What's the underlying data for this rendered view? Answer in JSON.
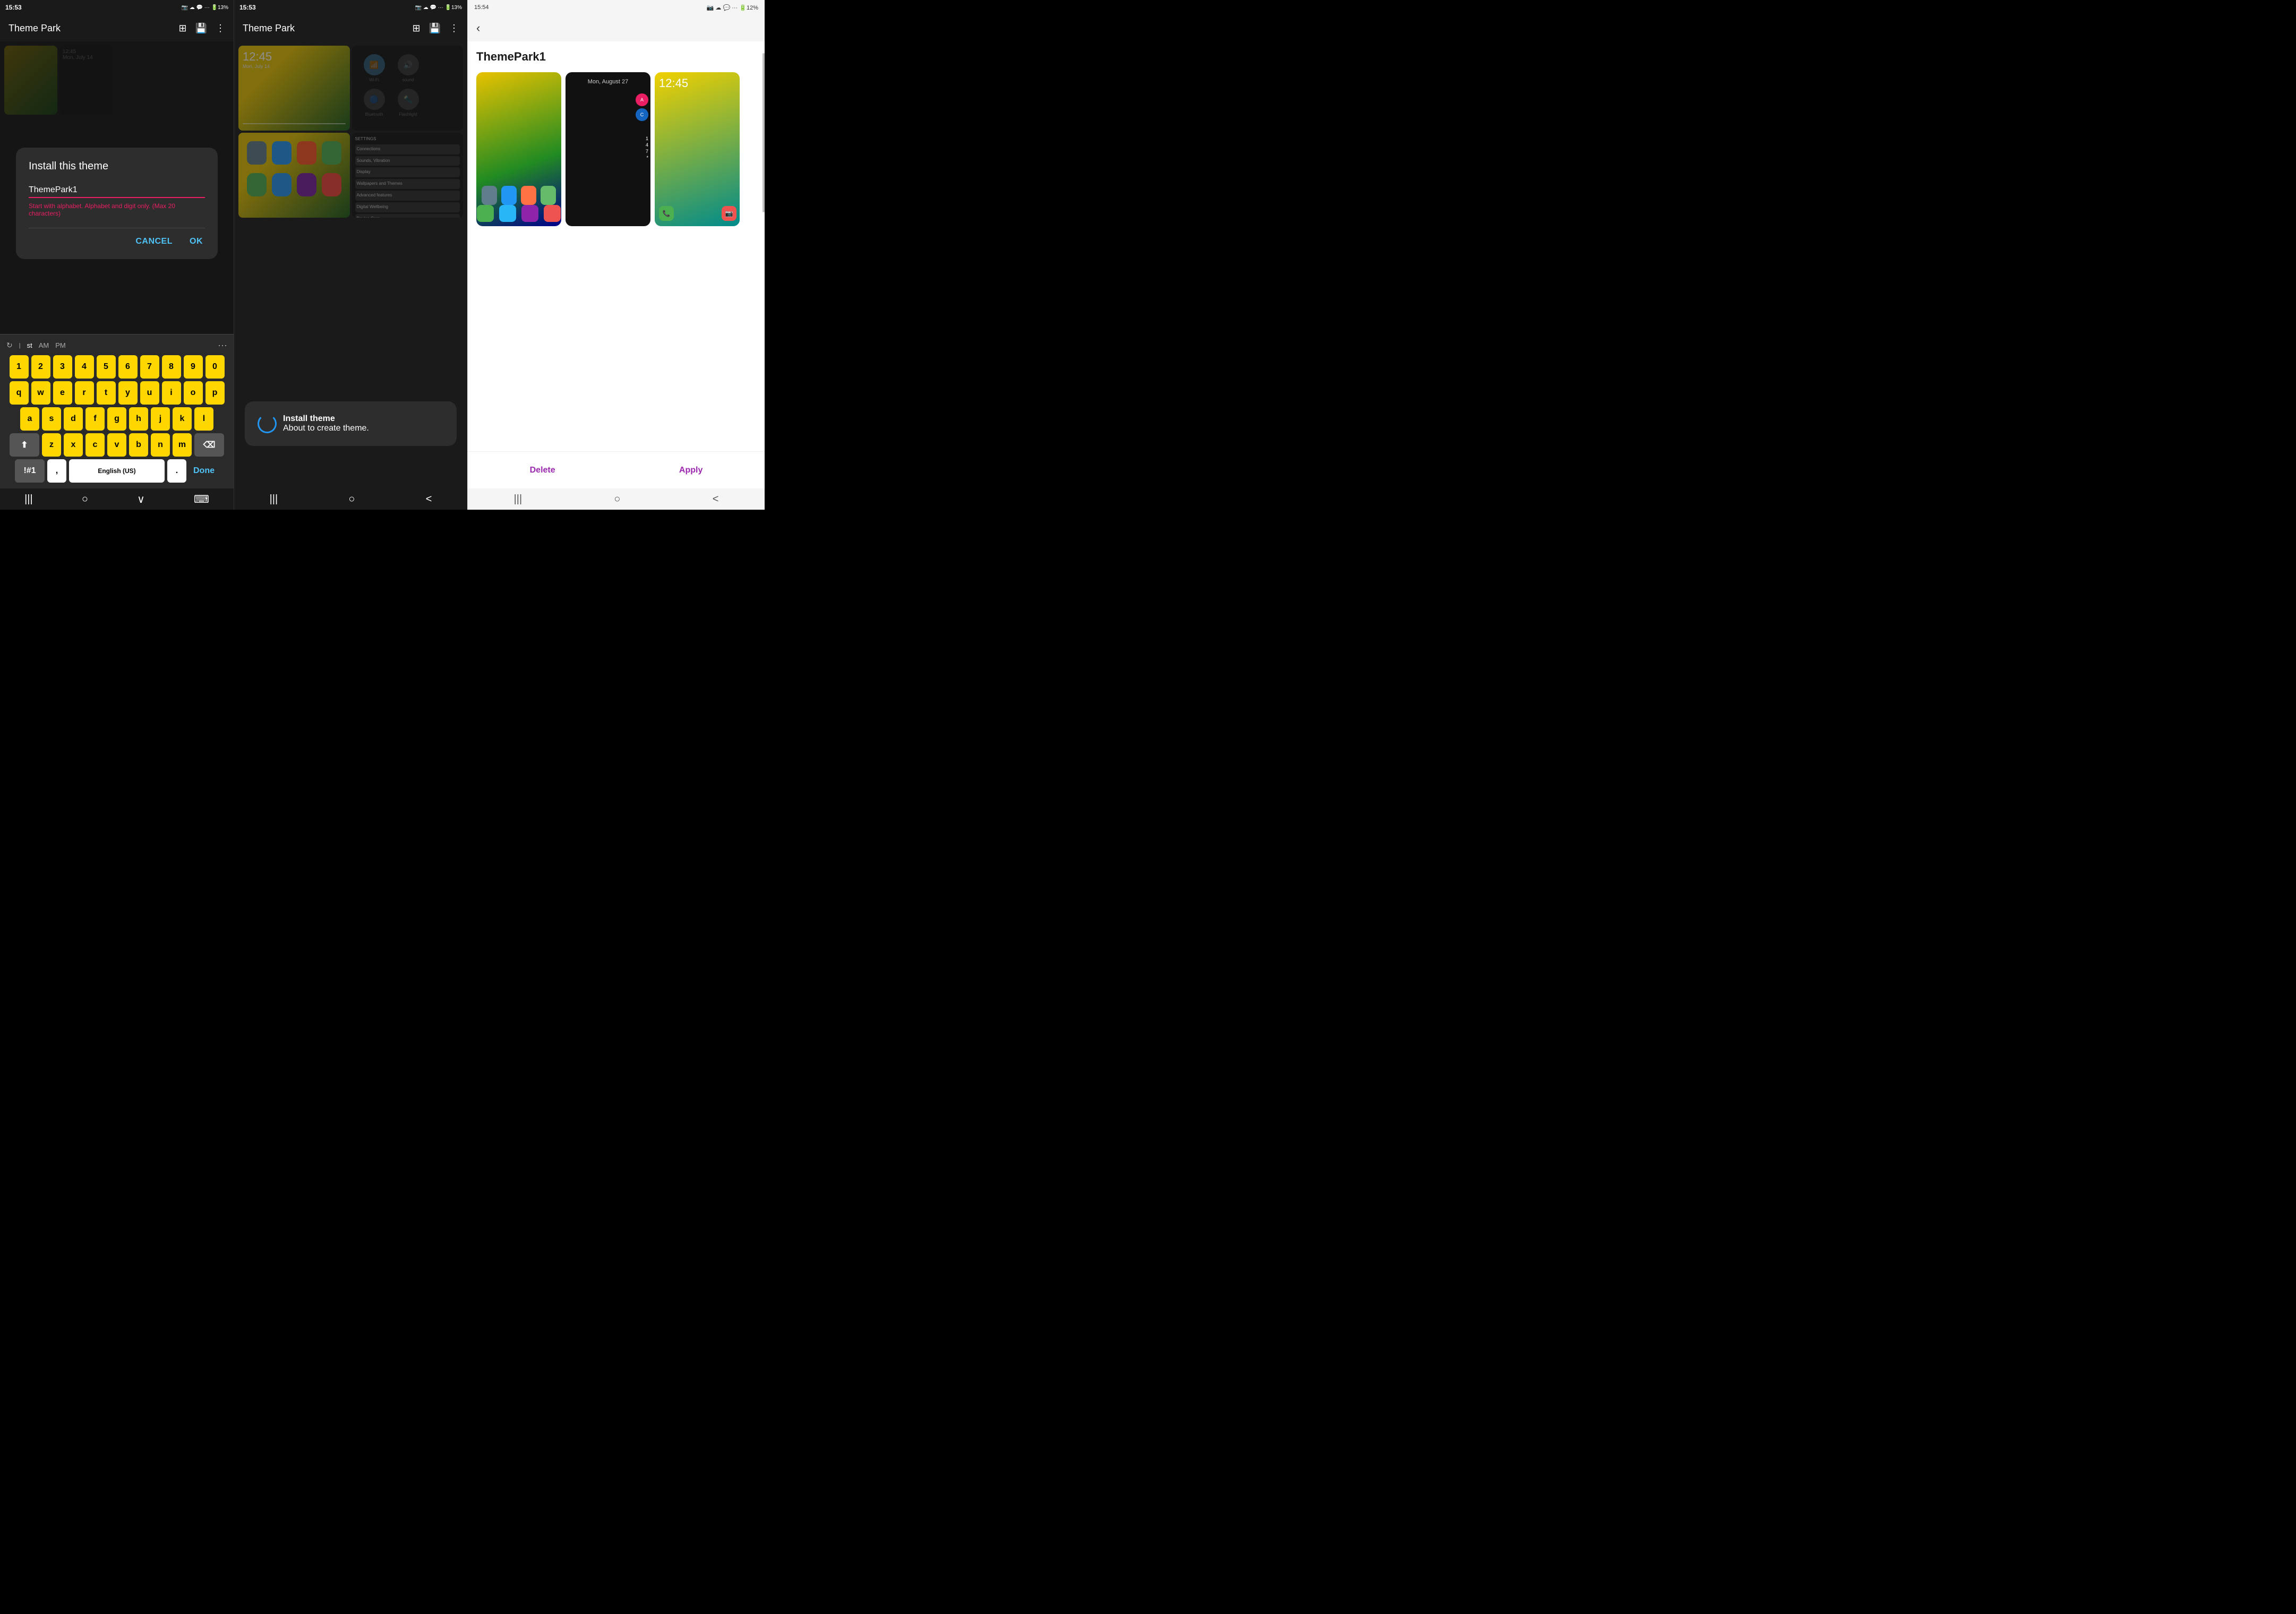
{
  "panel1": {
    "statusBar": {
      "time": "15:53",
      "icons": "📷 ☁ 💬 ···"
    },
    "appTitle": "Theme Park",
    "dialog": {
      "title": "Install this theme",
      "inputValue": "ThemePark1",
      "errorText": "Start with alphabet. Alphabet and digit only. (Max 20 characters)",
      "cancelLabel": "Cancel",
      "okLabel": "OK"
    },
    "keyboard": {
      "row0": [
        "1",
        "2",
        "3",
        "4",
        "5",
        "6",
        "7",
        "8",
        "9",
        "0"
      ],
      "row1": [
        "q",
        "w",
        "e",
        "r",
        "t",
        "y",
        "u",
        "i",
        "o",
        "p"
      ],
      "row2": [
        "a",
        "s",
        "d",
        "f",
        "g",
        "h",
        "j",
        "k",
        "l"
      ],
      "row3": [
        "z",
        "x",
        "c",
        "v",
        "b",
        "n",
        "m"
      ],
      "spaceLabel": "English (US)",
      "doneLabel": "Done",
      "symbolLabel": "!#1",
      "shiftLabel": "⬆",
      "backspaceLabel": "⌫"
    },
    "nav": {
      "menu": "|||",
      "home": "○",
      "back": "∨",
      "keyboard": "⌨"
    }
  },
  "panel2": {
    "statusBar": {
      "time": "15:53",
      "icons": "📷 ☁ 💬 ···"
    },
    "appTitle": "Theme Park",
    "installSheet": {
      "title": "Install theme",
      "text": "About to create theme."
    },
    "nav": {
      "menu": "|||",
      "home": "○",
      "back": "<"
    }
  },
  "panel3": {
    "statusBar": {
      "time": "15:54",
      "icons": "📷 ☁ 💬 ···"
    },
    "themeName": "ThemePark1",
    "preview1Date": "Mon, August 27",
    "preview2Date": "12:45",
    "deleteLabel": "Delete",
    "applyLabel": "Apply",
    "nav": {
      "menu": "|||",
      "home": "○",
      "back": "<"
    }
  },
  "quickSettings": {
    "items": [
      {
        "label": "sound",
        "icon": "🔊"
      },
      {
        "label": "Bluetooth",
        "icon": "🔵"
      },
      {
        "label": "Flashlight",
        "icon": "🔦"
      }
    ]
  }
}
